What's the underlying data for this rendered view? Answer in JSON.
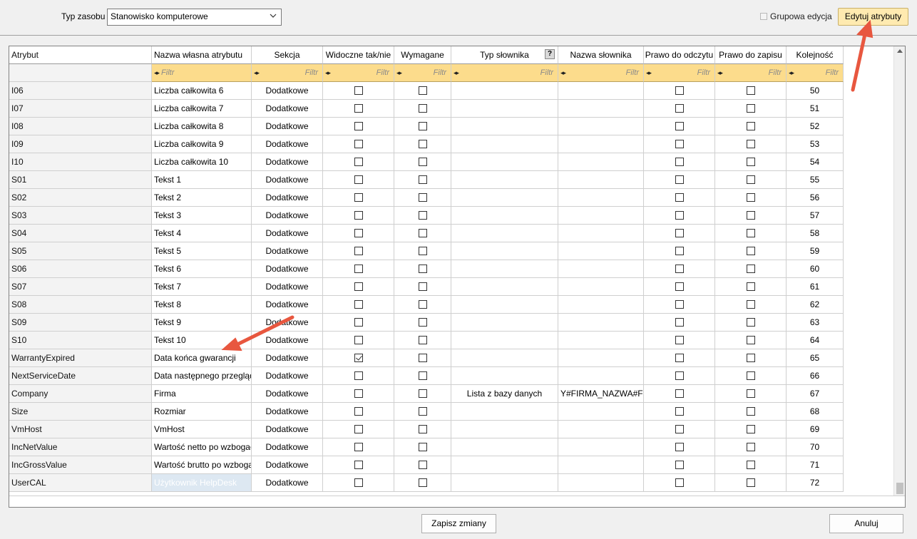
{
  "header": {
    "type_label": "Typ zasobu",
    "type_value": "Stanowisko komputerowe",
    "group_edit_label": "Grupowa edycja",
    "edit_attributes_label": "Edytuj atrybuty"
  },
  "columns": {
    "attr": "Atrybut",
    "name": "Nazwa własna atrybutu",
    "section": "Sekcja",
    "visible": "Widoczne tak/nie",
    "required": "Wymagane",
    "dict_type": "Typ słownika",
    "dict_help": "?",
    "dict_name": "Nazwa słownika",
    "read": "Prawo do odczytu",
    "write": "Prawo do zapisu",
    "order": "Kolejność"
  },
  "filter_placeholder": "Filtr",
  "rows": [
    {
      "attr": "I06",
      "name": "Liczba całkowita 6",
      "section": "Dodatkowe",
      "visible": false,
      "required": false,
      "dict_type": "",
      "dict_name": "",
      "read": false,
      "write": false,
      "order": "50"
    },
    {
      "attr": "I07",
      "name": "Liczba całkowita 7",
      "section": "Dodatkowe",
      "visible": false,
      "required": false,
      "dict_type": "",
      "dict_name": "",
      "read": false,
      "write": false,
      "order": "51"
    },
    {
      "attr": "I08",
      "name": "Liczba całkowita 8",
      "section": "Dodatkowe",
      "visible": false,
      "required": false,
      "dict_type": "",
      "dict_name": "",
      "read": false,
      "write": false,
      "order": "52"
    },
    {
      "attr": "I09",
      "name": "Liczba całkowita 9",
      "section": "Dodatkowe",
      "visible": false,
      "required": false,
      "dict_type": "",
      "dict_name": "",
      "read": false,
      "write": false,
      "order": "53"
    },
    {
      "attr": "I10",
      "name": "Liczba całkowita 10",
      "section": "Dodatkowe",
      "visible": false,
      "required": false,
      "dict_type": "",
      "dict_name": "",
      "read": false,
      "write": false,
      "order": "54"
    },
    {
      "attr": "S01",
      "name": "Tekst 1",
      "section": "Dodatkowe",
      "visible": false,
      "required": false,
      "dict_type": "",
      "dict_name": "",
      "read": false,
      "write": false,
      "order": "55"
    },
    {
      "attr": "S02",
      "name": "Tekst 2",
      "section": "Dodatkowe",
      "visible": false,
      "required": false,
      "dict_type": "",
      "dict_name": "",
      "read": false,
      "write": false,
      "order": "56"
    },
    {
      "attr": "S03",
      "name": "Tekst 3",
      "section": "Dodatkowe",
      "visible": false,
      "required": false,
      "dict_type": "",
      "dict_name": "",
      "read": false,
      "write": false,
      "order": "57"
    },
    {
      "attr": "S04",
      "name": "Tekst 4",
      "section": "Dodatkowe",
      "visible": false,
      "required": false,
      "dict_type": "",
      "dict_name": "",
      "read": false,
      "write": false,
      "order": "58"
    },
    {
      "attr": "S05",
      "name": "Tekst 5",
      "section": "Dodatkowe",
      "visible": false,
      "required": false,
      "dict_type": "",
      "dict_name": "",
      "read": false,
      "write": false,
      "order": "59"
    },
    {
      "attr": "S06",
      "name": "Tekst 6",
      "section": "Dodatkowe",
      "visible": false,
      "required": false,
      "dict_type": "",
      "dict_name": "",
      "read": false,
      "write": false,
      "order": "60"
    },
    {
      "attr": "S07",
      "name": "Tekst 7",
      "section": "Dodatkowe",
      "visible": false,
      "required": false,
      "dict_type": "",
      "dict_name": "",
      "read": false,
      "write": false,
      "order": "61"
    },
    {
      "attr": "S08",
      "name": "Tekst 8",
      "section": "Dodatkowe",
      "visible": false,
      "required": false,
      "dict_type": "",
      "dict_name": "",
      "read": false,
      "write": false,
      "order": "62"
    },
    {
      "attr": "S09",
      "name": "Tekst 9",
      "section": "Dodatkowe",
      "visible": false,
      "required": false,
      "dict_type": "",
      "dict_name": "",
      "read": false,
      "write": false,
      "order": "63"
    },
    {
      "attr": "S10",
      "name": "Tekst 10",
      "section": "Dodatkowe",
      "visible": false,
      "required": false,
      "dict_type": "",
      "dict_name": "",
      "read": false,
      "write": false,
      "order": "64"
    },
    {
      "attr": "WarrantyExpired",
      "name": "Data końca gwarancji",
      "section": "Dodatkowe",
      "visible": true,
      "required": false,
      "dict_type": "",
      "dict_name": "",
      "read": false,
      "write": false,
      "order": "65"
    },
    {
      "attr": "NextServiceDate",
      "name": "Data następnego przeglądu",
      "section": "Dodatkowe",
      "visible": false,
      "required": false,
      "dict_type": "",
      "dict_name": "",
      "read": false,
      "write": false,
      "order": "66"
    },
    {
      "attr": "Company",
      "name": "Firma",
      "section": "Dodatkowe",
      "visible": false,
      "required": false,
      "dict_type": "Lista z bazy danych",
      "dict_name": "Y#FIRMA_NAZWA#FIR",
      "read": false,
      "write": false,
      "order": "67"
    },
    {
      "attr": "Size",
      "name": "Rozmiar",
      "section": "Dodatkowe",
      "visible": false,
      "required": false,
      "dict_type": "",
      "dict_name": "",
      "read": false,
      "write": false,
      "order": "68"
    },
    {
      "attr": "VmHost",
      "name": "VmHost",
      "section": "Dodatkowe",
      "visible": false,
      "required": false,
      "dict_type": "",
      "dict_name": "",
      "read": false,
      "write": false,
      "order": "69"
    },
    {
      "attr": "IncNetValue",
      "name": "Wartość netto po wzbogaceniu",
      "section": "Dodatkowe",
      "visible": false,
      "required": false,
      "dict_type": "",
      "dict_name": "",
      "read": false,
      "write": false,
      "order": "70"
    },
    {
      "attr": "IncGrossValue",
      "name": "Wartość brutto po wzbogaceniu",
      "section": "Dodatkowe",
      "visible": false,
      "required": false,
      "dict_type": "",
      "dict_name": "",
      "read": false,
      "write": false,
      "order": "71"
    },
    {
      "attr": "UserCAL",
      "name": "Użytkownik HelpDesk",
      "section": "Dodatkowe",
      "visible": false,
      "required": false,
      "dict_type": "",
      "dict_name": "",
      "read": false,
      "write": false,
      "order": "72",
      "selected": true
    }
  ],
  "footer": {
    "save_label": "Zapisz zmiany",
    "cancel_label": "Anuluj"
  },
  "colors": {
    "filter_row": "#fcdc8c",
    "edit_button": "#ffeab0",
    "annotation_arrow": "#e8573f"
  }
}
